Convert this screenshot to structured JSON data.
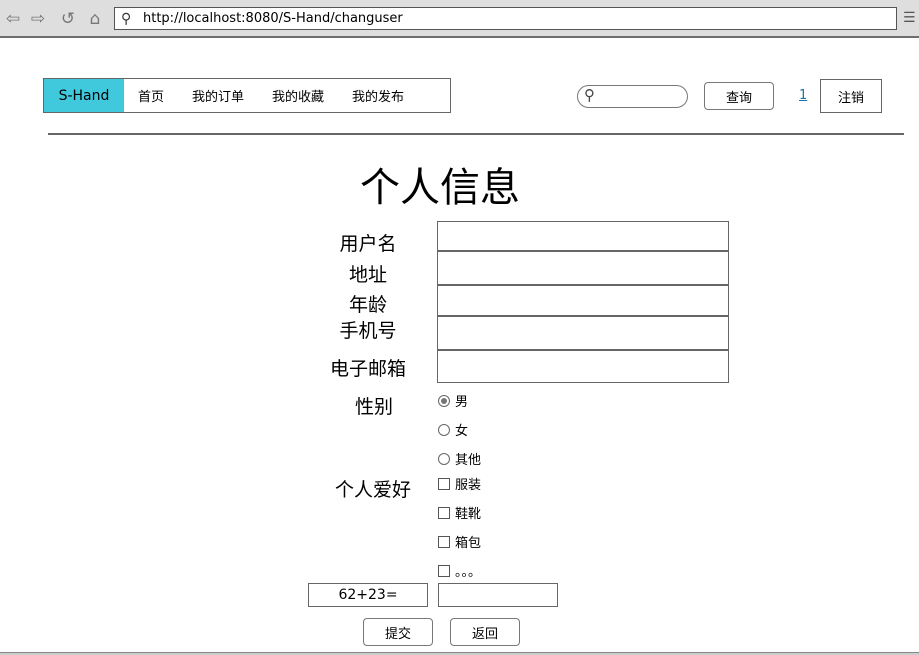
{
  "browser": {
    "url": "http://localhost:8080/S-Hand/changuser"
  },
  "nav": {
    "brand": "S-Hand",
    "items": [
      "首页",
      "我的订单",
      "我的收藏",
      "我的发布"
    ]
  },
  "header": {
    "search_placeholder": "",
    "query_label": "查询",
    "user_link": "1",
    "logout_label": "注销"
  },
  "form": {
    "title": "个人信息",
    "fields": [
      {
        "label": "用户名",
        "value": ""
      },
      {
        "label": "地址",
        "value": ""
      },
      {
        "label": "年龄",
        "value": ""
      },
      {
        "label": "手机号",
        "value": ""
      },
      {
        "label": "电子邮箱",
        "value": ""
      }
    ],
    "gender": {
      "label": "性别",
      "options": [
        "男",
        "女",
        "其他"
      ],
      "selected": "男"
    },
    "hobbies": {
      "label": "个人爱好",
      "options": [
        "服装",
        "鞋靴",
        "箱包",
        "。。。"
      ],
      "checked": []
    },
    "captcha": {
      "question": "62+23=",
      "answer": ""
    },
    "submit_label": "提交",
    "back_label": "返回"
  },
  "colors": {
    "brand": "#40c8dc"
  }
}
